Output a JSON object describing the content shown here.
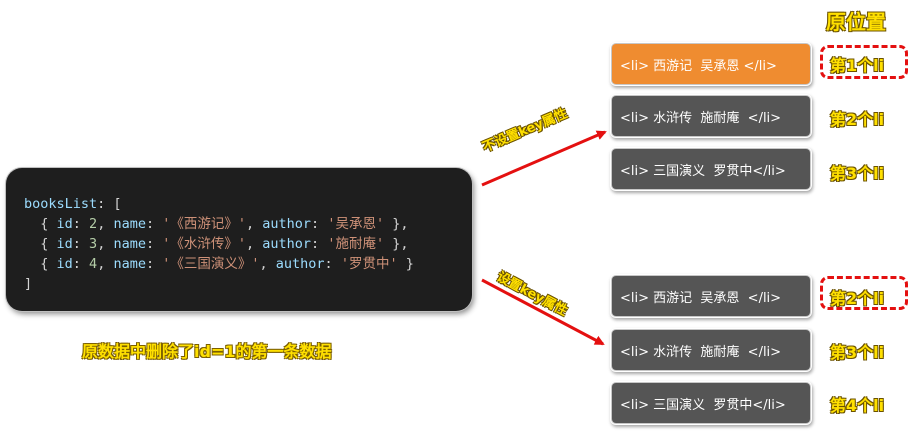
{
  "code": {
    "line1_key": "booksList",
    "line1_rest": ": [",
    "rows": [
      {
        "id": "2",
        "name": "'《西游记》'",
        "author": "'吴承恩'",
        "end": " },"
      },
      {
        "id": "3",
        "name": "'《水浒传》'",
        "author": "'施耐庵'",
        "end": " },"
      },
      {
        "id": "4",
        "name": "'《三国演义》'",
        "author": "'罗贯中'",
        "end": " }"
      }
    ],
    "last_line": "]"
  },
  "caption": "原数据中删除了id=1的第一条数据",
  "position_title": "原位置",
  "arrows": {
    "top_label": "不设置key属性",
    "bottom_label": "设置key属性"
  },
  "top_group": {
    "items": [
      {
        "text": "<li> 西游记  吴承恩 </li>",
        "style": "orange"
      },
      {
        "text": "<li> 水浒传  施耐庵  </li>",
        "style": "gray"
      },
      {
        "text": "<li> 三国演义  罗贯中</li>",
        "style": "gray"
      }
    ],
    "positions": [
      "第1个li",
      "第2个li",
      "第3个li"
    ]
  },
  "bottom_group": {
    "items": [
      {
        "text": "<li> 西游记  吴承恩  </li>",
        "style": "gray"
      },
      {
        "text": "<li> 水浒传  施耐庵  </li>",
        "style": "gray"
      },
      {
        "text": "<li> 三国演义  罗贯中</li>",
        "style": "gray"
      }
    ],
    "positions": [
      "第2个li",
      "第3个li",
      "第4个li"
    ]
  },
  "colors": {
    "arrow": "#e41010",
    "highlight": "#ffe000",
    "orange_item": "#ef8c30",
    "gray_item": "#555555"
  }
}
